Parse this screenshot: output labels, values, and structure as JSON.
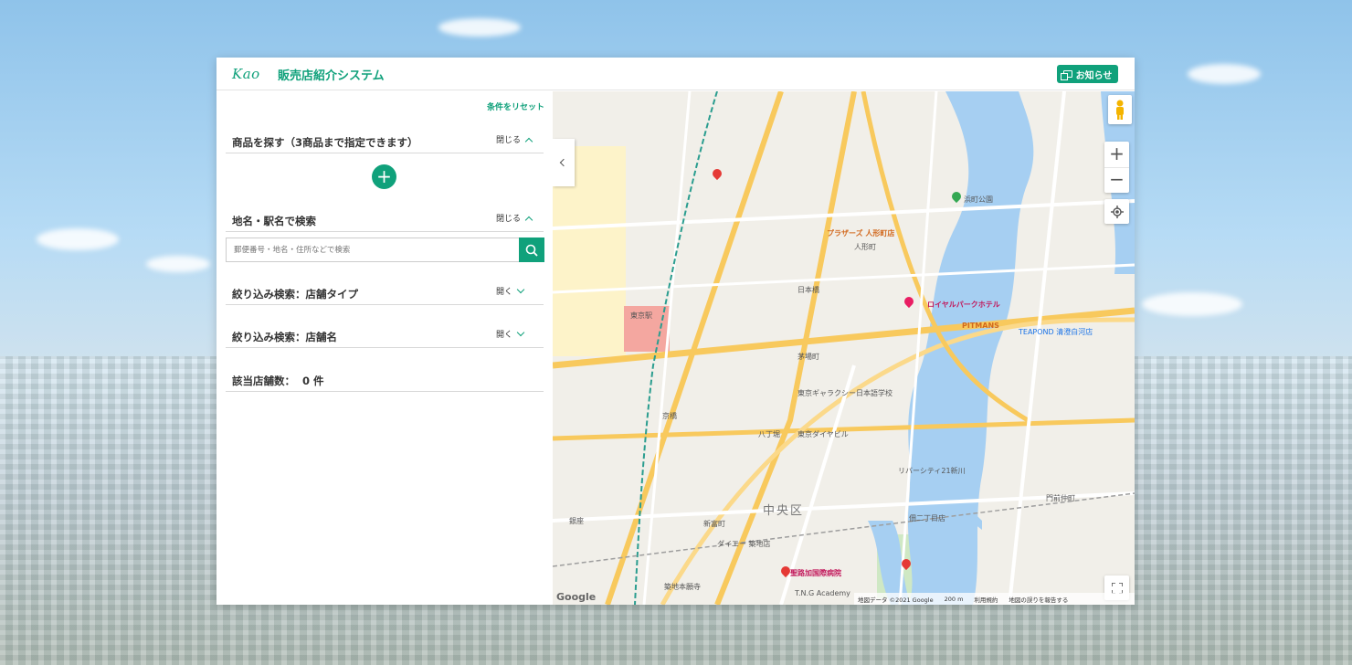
{
  "header": {
    "logo": "Kao",
    "title": "販売店紹介システム",
    "notice_button": "お知らせ"
  },
  "sidebar": {
    "reset_link": "条件をリセット",
    "product_section": {
      "label": "商品を探す（3商品まで指定できます）",
      "toggle": "閉じる"
    },
    "add_button": "+",
    "location_section": {
      "label": "地名・駅名で検索",
      "toggle": "閉じる"
    },
    "search": {
      "placeholder": "郵便番号・地名・住所などで検索",
      "value": ""
    },
    "store_type_section": {
      "label": "絞り込み検索：店舗タイプ",
      "toggle": "開く"
    },
    "store_name_section": {
      "label": "絞り込み検索：店舗名",
      "toggle": "開く"
    },
    "result_count": {
      "label": "該当店舗数：",
      "value": "0 件"
    }
  },
  "map": {
    "labels": {
      "district": "中央区",
      "nihonbashi": "日本橋",
      "tokyo_station": "東京駅",
      "ningyocho": "人形町",
      "royal_park": "ロイヤルパークホテル",
      "plazas": "プラザーズ 人形町店",
      "st_lukes": "聖路加国際病院",
      "pitmans": "PITMANS",
      "teapond": "TEAPOND 清澄白河店",
      "tokyo_daiyabiru": "東京ダイヤビル",
      "river_city": "リバーシティ21新川",
      "tsukiji": "築地本願寺",
      "shin_tomicho": "新富町",
      "tsukudajima": "佃二丁目店",
      "kyobashi": "京橋",
      "hacchobori": "八丁堀",
      "kayabacho": "茅場町",
      "hamacho": "浜町公園",
      "ginza": "銀座",
      "monzennakacho": "門前仲町",
      "tng": "T.N.G Academy",
      "daiei": "ダイエー 築地店",
      "tokyo_kaikan": "東京ギャラクシー日本語学校"
    },
    "footer": {
      "map_data": "地図データ ©2021 Google",
      "scale": "200 m",
      "terms": "利用規約",
      "report": "地図の誤りを報告する"
    },
    "google": "Google",
    "zoom_in": "+",
    "zoom_out": "−"
  }
}
